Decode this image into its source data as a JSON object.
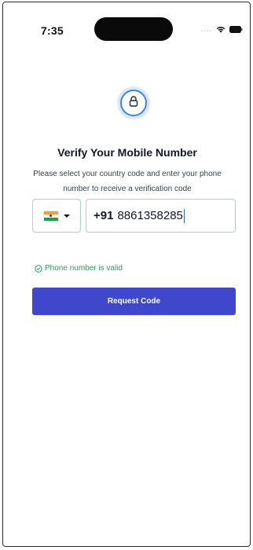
{
  "status_bar": {
    "time": "7:35",
    "signal": "....",
    "wifi_icon": "wifi-icon",
    "battery_icon": "battery-icon"
  },
  "header": {
    "icon": "lock-icon",
    "title": "Verify Your Mobile Number",
    "subtitle": "Please select your country code and enter your phone number to receive a verification code"
  },
  "phone_form": {
    "country_flag": "india-flag-icon",
    "country_dial_code": "+91",
    "phone_number": "8861358285",
    "validation_message": "Phone number is valid",
    "request_button_label": "Request Code"
  },
  "colors": {
    "accent": "#3f48cc",
    "valid": "#22a05a",
    "field_border": "#a7d7b9",
    "lock_ring": "#3b82f6"
  }
}
